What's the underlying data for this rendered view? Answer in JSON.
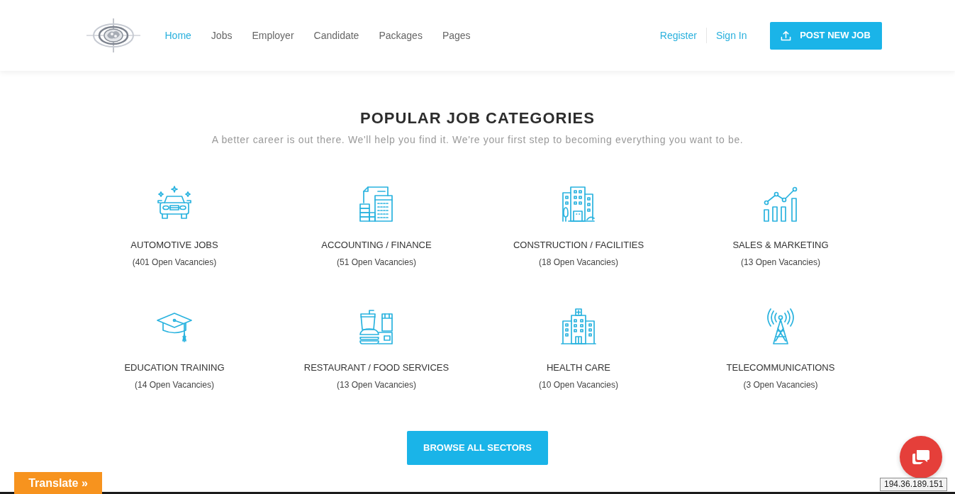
{
  "header": {
    "nav": [
      {
        "label": "Home",
        "selected": true
      },
      {
        "label": "Jobs",
        "selected": false
      },
      {
        "label": "Employer",
        "selected": false
      },
      {
        "label": "Candidate",
        "selected": false
      },
      {
        "label": "Packages",
        "selected": false
      },
      {
        "label": "Pages",
        "selected": false
      }
    ],
    "auth_links": [
      "Register",
      "Sign In"
    ],
    "post_button": "POST NEW JOB"
  },
  "section": {
    "title": "POPULAR JOB CATEGORIES",
    "subtitle": "A better career is out there. We'll help you find it. We're your first step to becoming everything you want to be."
  },
  "categories": [
    {
      "name": "AUTOMOTIVE JOBS",
      "count": "(401 Open Vacancies)"
    },
    {
      "name": "ACCOUNTING / FINANCE",
      "count": "(51 Open Vacancies)"
    },
    {
      "name": "CONSTRUCTION / FACILITIES",
      "count": "(18 Open Vacancies)"
    },
    {
      "name": "SALES & MARKETING",
      "count": "(13 Open Vacancies)"
    },
    {
      "name": "EDUCATION TRAINING",
      "count": "(14 Open Vacancies)"
    },
    {
      "name": "RESTAURANT / FOOD SERVICES",
      "count": "(13 Open Vacancies)"
    },
    {
      "name": "HEALTH CARE",
      "count": "(10 Open Vacancies)"
    },
    {
      "name": "TELECOMMUNICATIONS",
      "count": "(3 Open Vacancies)"
    }
  ],
  "browse_button": "BROWSE ALL SECTORS",
  "translate_button": "Translate »",
  "ip_tooltip": "194.36.189.151"
}
